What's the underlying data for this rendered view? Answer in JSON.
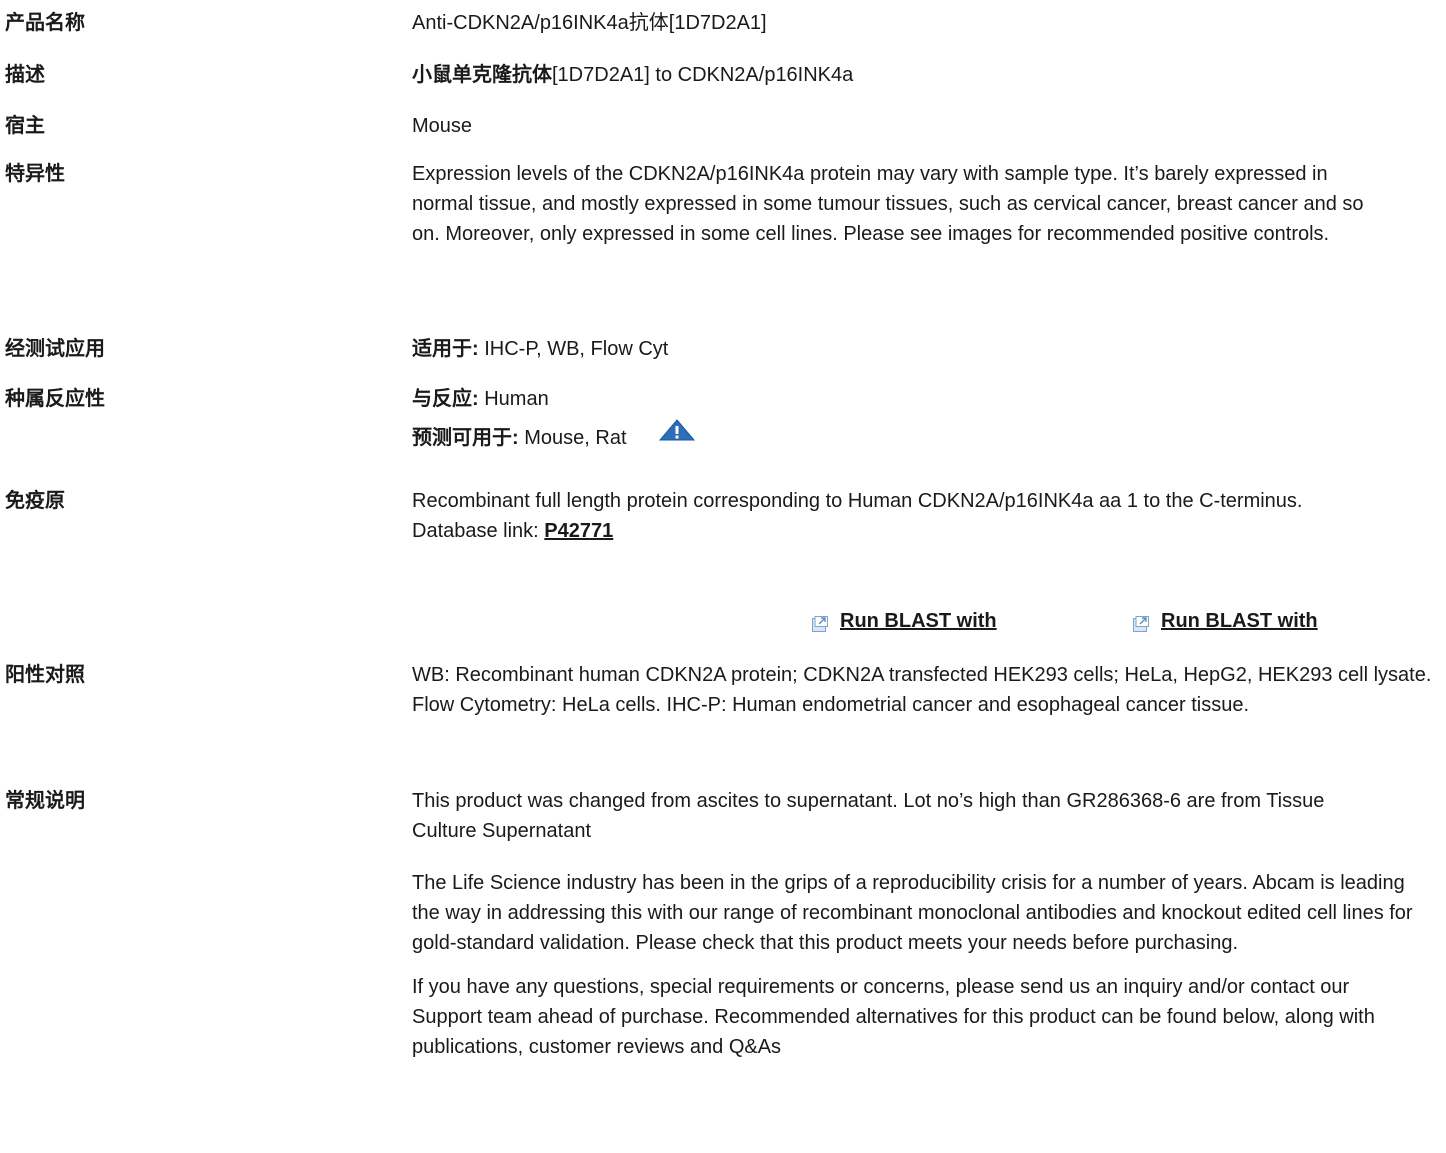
{
  "rows": {
    "product_name": {
      "label": "产品名称",
      "value": "Anti-CDKN2A/p16INK4a抗体[1D7D2A1]"
    },
    "description": {
      "label": "描述",
      "value_bold": "小鼠单克隆抗体",
      "value_rest": "[1D7D2A1] to CDKN2A/p16INK4a"
    },
    "host": {
      "label": "宿主",
      "value": "Mouse"
    },
    "specificity": {
      "label": "特异性",
      "value": "Expression levels of the CDKN2A/p16INK4a protein may vary with sample type. It’s barely expressed in normal tissue, and mostly expressed in some tumour tissues, such as cervical cancer, breast cancer and so on. Moreover, only expressed in some cell lines. Please see images for recommended positive controls."
    },
    "tested_applications": {
      "label": "经测试应用",
      "suitable_label": "适用于:",
      "suitable_value": " IHC-P, WB, Flow Cyt"
    },
    "species_reactivity": {
      "label": "种属反应性",
      "reacts_label": "与反应:",
      "reacts_value": " Human",
      "predicted_label": "预测可用于:",
      "predicted_value": " Mouse, Rat"
    },
    "immunogen": {
      "label": "免疫原",
      "value": "Recombinant full length protein corresponding to Human CDKN2A/p16INK4a aa 1 to the C-terminus.",
      "db_prefix": "Database link: ",
      "db_link": "P42771",
      "blast_1": "Run BLAST with",
      "blast_2": "Run BLAST with"
    },
    "positive_control": {
      "label": "阳性对照",
      "value": "WB: Recombinant human CDKN2A protein; CDKN2A transfected HEK293 cells; HeLa, HepG2, HEK293 cell lysate. Flow Cytometry: HeLa cells. IHC-P: Human endometrial cancer and esophageal cancer tissue."
    },
    "general_notes": {
      "label": "常规说明",
      "para1": "This product was changed from ascites to supernatant. Lot no’s high than GR286368-6 are from Tissue Culture Supernatant",
      "para2": "The Life Science industry has been in the grips of a reproducibility crisis for a number of years. Abcam is leading the way in addressing this with our range of recombinant monoclonal antibodies and knockout edited cell lines for gold-standard validation. Please check that this product meets your needs before purchasing.",
      "para3": "If you have any questions, special requirements or concerns, please send us an inquiry and/or contact our Support team ahead of purchase. Recommended alternatives for this product can be found below, along with publications, customer reviews and Q&As"
    }
  },
  "colors": {
    "text": "#1a1a1a",
    "warning_icon": "#2a6fb8",
    "ext_icon": "#7fa4cc"
  },
  "icons": {
    "warning": "warning-triangle-icon",
    "external": "external-link-icon"
  }
}
